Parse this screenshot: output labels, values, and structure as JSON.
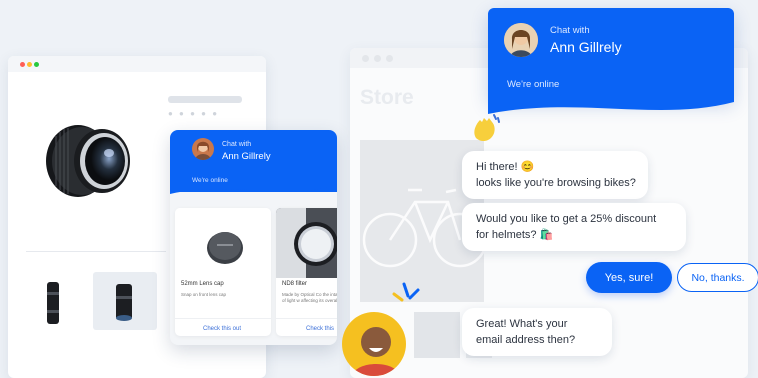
{
  "left_widget": {
    "chat_with": "Chat with",
    "agent_name": "Ann Gillrely",
    "status": "We're online",
    "products": [
      {
        "name": "52mm Lens cap",
        "description": "Snap on front lens cap",
        "cta": "Check this out"
      },
      {
        "name": "ND8 filter",
        "description": "Made by Optical Co the intake of light w affecting its overall",
        "cta": "Check this"
      }
    ]
  },
  "right_store": {
    "title": "Store"
  },
  "main_chat": {
    "chat_with": "Chat with",
    "agent_name": "Ann Gillrely",
    "status": "We're online",
    "messages": [
      {
        "line1": "Hi there! 😊",
        "line2": "looks like you're browsing bikes?"
      },
      {
        "line1": "Would you like to get a 25% discount",
        "line2": "for helmets? 🛍️"
      },
      {
        "line1": "Great! What's your",
        "line2": "email address then?"
      }
    ],
    "replies": {
      "yes": "Yes, sure!",
      "no": "No, thanks."
    }
  },
  "icons": {
    "wave": "waving-hand-icon",
    "sparks": "sparkle-lines-icon"
  },
  "colors": {
    "brand_blue": "#0a63f5",
    "background": "#eef2f7"
  }
}
